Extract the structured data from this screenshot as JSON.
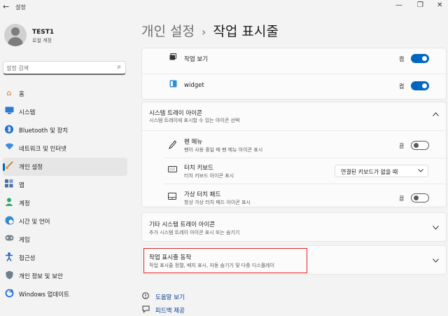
{
  "window": {
    "title": "설정",
    "back_glyph": "←",
    "minimize_glyph": "—",
    "maximize_glyph": "❐",
    "close_glyph": "✕"
  },
  "user": {
    "name": "TEST1",
    "account_type": "로컬 계정"
  },
  "search": {
    "placeholder": "설정 검색"
  },
  "nav": {
    "items": [
      {
        "label": "홈",
        "icon": "home-icon"
      },
      {
        "label": "시스템",
        "icon": "monitor-icon"
      },
      {
        "label": "Bluetooth 및 장치",
        "icon": "bluetooth-icon"
      },
      {
        "label": "네트워크 및 인터넷",
        "icon": "wifi-icon"
      },
      {
        "label": "개인 설정",
        "icon": "brush-icon"
      },
      {
        "label": "앱",
        "icon": "apps-icon"
      },
      {
        "label": "계정",
        "icon": "person-icon"
      },
      {
        "label": "시간 및 언어",
        "icon": "globe-clock-icon"
      },
      {
        "label": "게임",
        "icon": "gamepad-icon"
      },
      {
        "label": "접근성",
        "icon": "accessibility-icon"
      },
      {
        "label": "개인 정보 및 보안",
        "icon": "shield-icon"
      },
      {
        "label": "Windows 업데이트",
        "icon": "update-icon"
      }
    ],
    "active_index": 4
  },
  "header": {
    "parent": "개인 설정",
    "separator": "›",
    "current": "작업 표시줄"
  },
  "taskbar_items": {
    "task_view": {
      "label": "작업 보기",
      "state": "켬"
    },
    "widget": {
      "label": "widget",
      "state": "켬"
    }
  },
  "tray": {
    "title": "시스템 트레이 아이콘",
    "subtitle": "시스템 트레이에 표시할 수 있는 아이콘 선택",
    "pen_menu": {
      "title": "펜 메뉴",
      "subtitle": "펜이 사용 중일 때 펜 메뉴 아이콘 표시",
      "state": "끔"
    },
    "touch_keyboard": {
      "title": "터치 키보드",
      "subtitle": "터치 키보드 아이콘 표시",
      "selected": "연결된 키보드가 없을 때"
    },
    "virtual_touchpad": {
      "title": "가상 터치 패드",
      "subtitle": "항상 가상 터치 패드 아이콘 표시",
      "state": "끔"
    }
  },
  "other_tray": {
    "title": "기타 시스템 트레이 아이콘",
    "subtitle": "추가 시스템 트레이 아이콘 표시 또는 숨기기"
  },
  "behaviors": {
    "title": "작업 표시줄 동작",
    "subtitle": "작업 표시줄 정렬, 배지 표시, 자동 숨기기 및 다중 디스플레이"
  },
  "links": {
    "help": "도움말 보기",
    "feedback": "피드백 제공"
  }
}
